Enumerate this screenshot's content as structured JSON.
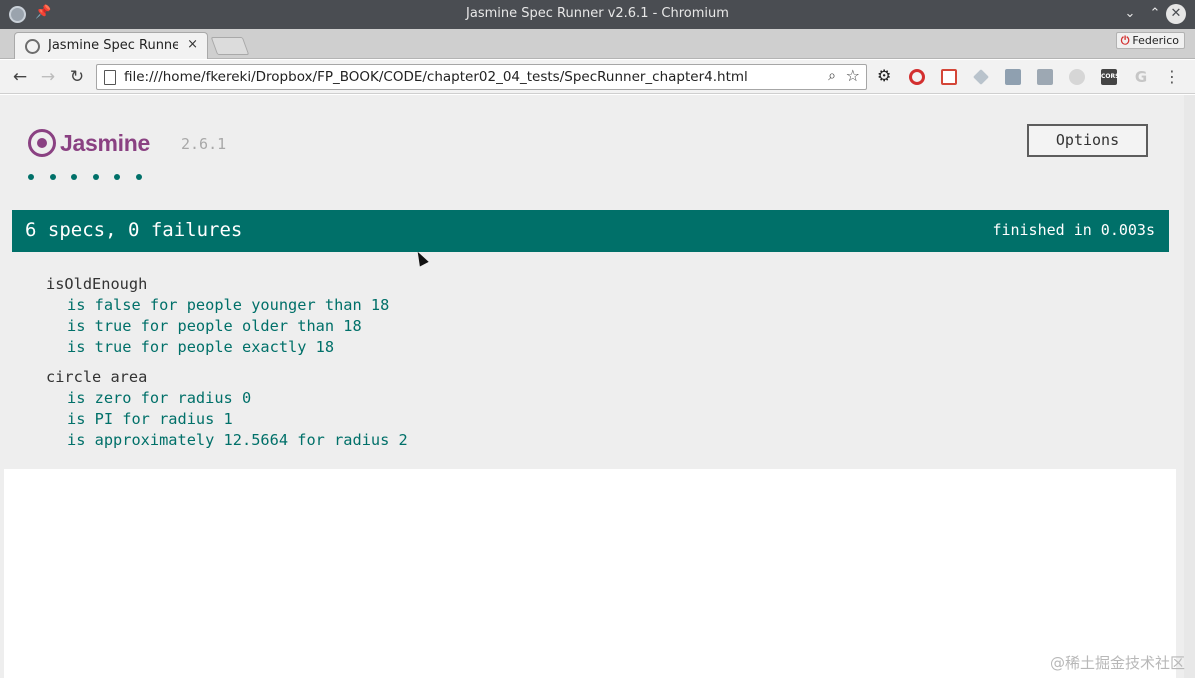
{
  "window": {
    "title": "Jasmine Spec Runner v2.6.1 - Chromium",
    "minimize": "⌄",
    "maximize": "⌃",
    "close": "✕"
  },
  "tabs": [
    {
      "title": "Jasmine Spec Runner",
      "close": "×"
    }
  ],
  "profile": {
    "icon": "⏻",
    "name": "Federico"
  },
  "toolbar": {
    "back": "←",
    "forward": "→",
    "reload": "↻",
    "url": "file:///home/fkereki/Dropbox/FP_BOOK/CODE/chapter02_04_tests/SpecRunner_chapter4.html",
    "zoom": "⌕",
    "star": "☆",
    "extensions": [
      "gear-icon",
      "opera-icon",
      "gmail-icon",
      "dropbox-icon",
      "pocket-icon",
      "qr-icon",
      "circle-icon",
      "cors-icon",
      "google-icon",
      "menu-icon"
    ],
    "cors_label": "CORS",
    "google_label": "G",
    "menu_label": "⋮",
    "gear_label": "⚙"
  },
  "jasmine": {
    "logo_text": "Jasmine",
    "version": "2.6.1",
    "options_label": "Options",
    "dot_count": 6,
    "accent": "#007069",
    "logo_color": "#8a4182"
  },
  "banner": {
    "summary": "6 specs, 0 failures",
    "duration": "finished in 0.003s",
    "color": "#007069"
  },
  "suites": [
    {
      "title": "isOldEnough",
      "specs": [
        "is false for people younger than 18",
        "is true for people older than 18",
        "is true for people exactly 18"
      ]
    },
    {
      "title": "circle area",
      "specs": [
        "is zero for radius 0",
        "is PI for radius 1",
        "is approximately 12.5664 for radius 2"
      ]
    }
  ],
  "watermark": "@稀土掘金技术社区"
}
